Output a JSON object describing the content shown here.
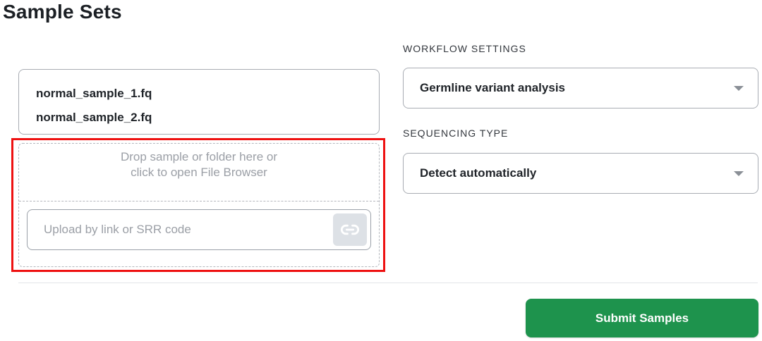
{
  "page": {
    "title": "Sample Sets"
  },
  "files": [
    "normal_sample_1.fq",
    "normal_sample_2.fq"
  ],
  "upload": {
    "drop_text": "Drop sample or folder here or click to open File Browser",
    "link_placeholder": "Upload by link or SRR code",
    "link_value": "",
    "link_icon": "link-icon"
  },
  "workflow": {
    "label": "WORKFLOW SETTINGS",
    "selected": "Germline variant analysis"
  },
  "sequencing": {
    "label": "SEQUENCING TYPE",
    "selected": "Detect automatically"
  },
  "actions": {
    "submit_label": "Submit Samples"
  },
  "colors": {
    "accent": "#1e934d",
    "highlight": "#ee1111",
    "muted_text": "#9b9fa6"
  }
}
